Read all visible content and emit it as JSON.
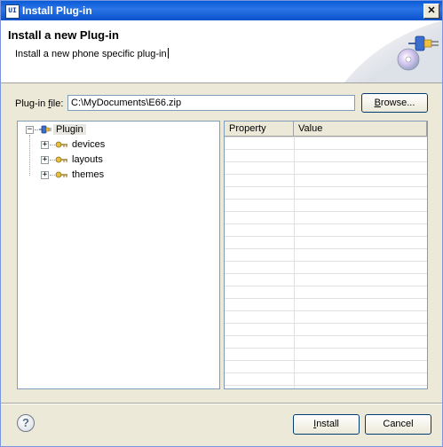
{
  "window": {
    "title": "Install Plug-in",
    "app_icon": "UI",
    "close_glyph": "✕"
  },
  "banner": {
    "heading": "Install a new Plug-in",
    "description": "Install a new phone specific plug-in"
  },
  "file_row": {
    "label_prefix": "Plug-in ",
    "label_mnemonic": "f",
    "label_suffix": "ile:",
    "value": "C:\\MyDocuments\\E66.zip",
    "browse_mnemonic": "B",
    "browse_rest": "rowse..."
  },
  "tree": {
    "root": {
      "label": "Plugin",
      "expander": "−"
    },
    "children": [
      {
        "label": "devices",
        "expander": "+"
      },
      {
        "label": "layouts",
        "expander": "+"
      },
      {
        "label": "themes",
        "expander": "+"
      }
    ]
  },
  "properties": {
    "col_property": "Property",
    "col_value": "Value"
  },
  "footer": {
    "help_glyph": "?",
    "install_mnemonic": "I",
    "install_rest": "nstall",
    "cancel_label": "Cancel"
  },
  "colors": {
    "titlebar": "#0a5bd7",
    "dialog_bg": "#ece9d8",
    "plug_icon": "#c8a02a"
  }
}
